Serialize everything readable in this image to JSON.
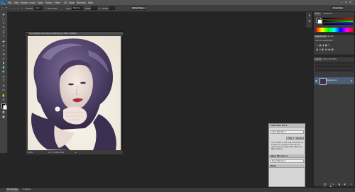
{
  "menubar": {
    "logo": "Ps",
    "items": [
      "File",
      "Edit",
      "Image",
      "Layer",
      "Type",
      "Select",
      "Filter",
      "3D",
      "View",
      "Window",
      "Help"
    ],
    "window_controls": [
      "–",
      "▫",
      "✕"
    ]
  },
  "options": {
    "feather_label": "Feather:",
    "feather_value": "0 px",
    "antialias_label": "Anti-alias",
    "style_label": "Style:",
    "style_value": "Normal",
    "width_label": "Width:",
    "height_label": "Height:",
    "refine_label": "Refine Edge...",
    "workspace_value": "Essentials"
  },
  "document": {
    "title": "Color-Website-free-hair-portrait.jpg @ 100% (RGB/8)",
    "zoom": "100%",
    "doc_size": "Doc: 1.93M/1.93M"
  },
  "panels": {
    "color_tabs": [
      "Color",
      "Swatches"
    ],
    "adjust_tabs": [
      "Adjustments",
      "Styles"
    ],
    "adjust_title": "Add an adjustment",
    "layers_tabs": [
      "Layers",
      "Channels",
      "Paths"
    ],
    "layer_name": "Background"
  },
  "cef": {
    "header1": "Color Efex Pro 4",
    "row1": "Color Efex Pro 4",
    "filter_btn": "Filter",
    "recipes_btn": "Recipes",
    "help_text": "To use filters in this case, there filter as a Smart, by clicking on the link. You need to be and apply them within the filter interface.",
    "header2": "Silver Efex Pro 2",
    "row2": "Silver Efex Pro 2",
    "header3": "Tools",
    "settings": "Settings"
  },
  "bottom": {
    "tabs": [
      "Mini Bridge",
      "Timeline"
    ]
  },
  "colors": {
    "accent_blue": "#0b2b4f",
    "fg_color": "#000000",
    "bg_color": "#ffffff"
  }
}
